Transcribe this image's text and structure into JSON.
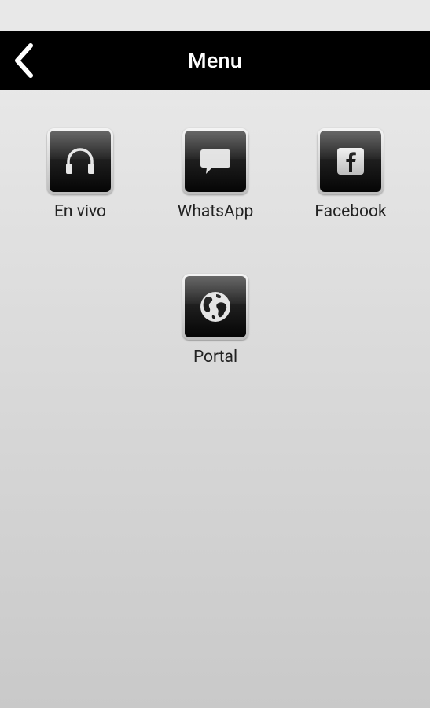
{
  "header": {
    "title": "Menu",
    "back_icon": "chevron-left-icon"
  },
  "menu": {
    "items": [
      {
        "label": "En vivo",
        "icon": "headphones-icon"
      },
      {
        "label": "WhatsApp",
        "icon": "chat-bubble-icon"
      },
      {
        "label": "Facebook",
        "icon": "facebook-icon"
      },
      {
        "label": "Portal",
        "icon": "globe-icon"
      }
    ]
  },
  "colors": {
    "header_bg": "#000000",
    "header_text": "#ffffff",
    "tile_dark": "#050505",
    "label_text": "#222222"
  }
}
